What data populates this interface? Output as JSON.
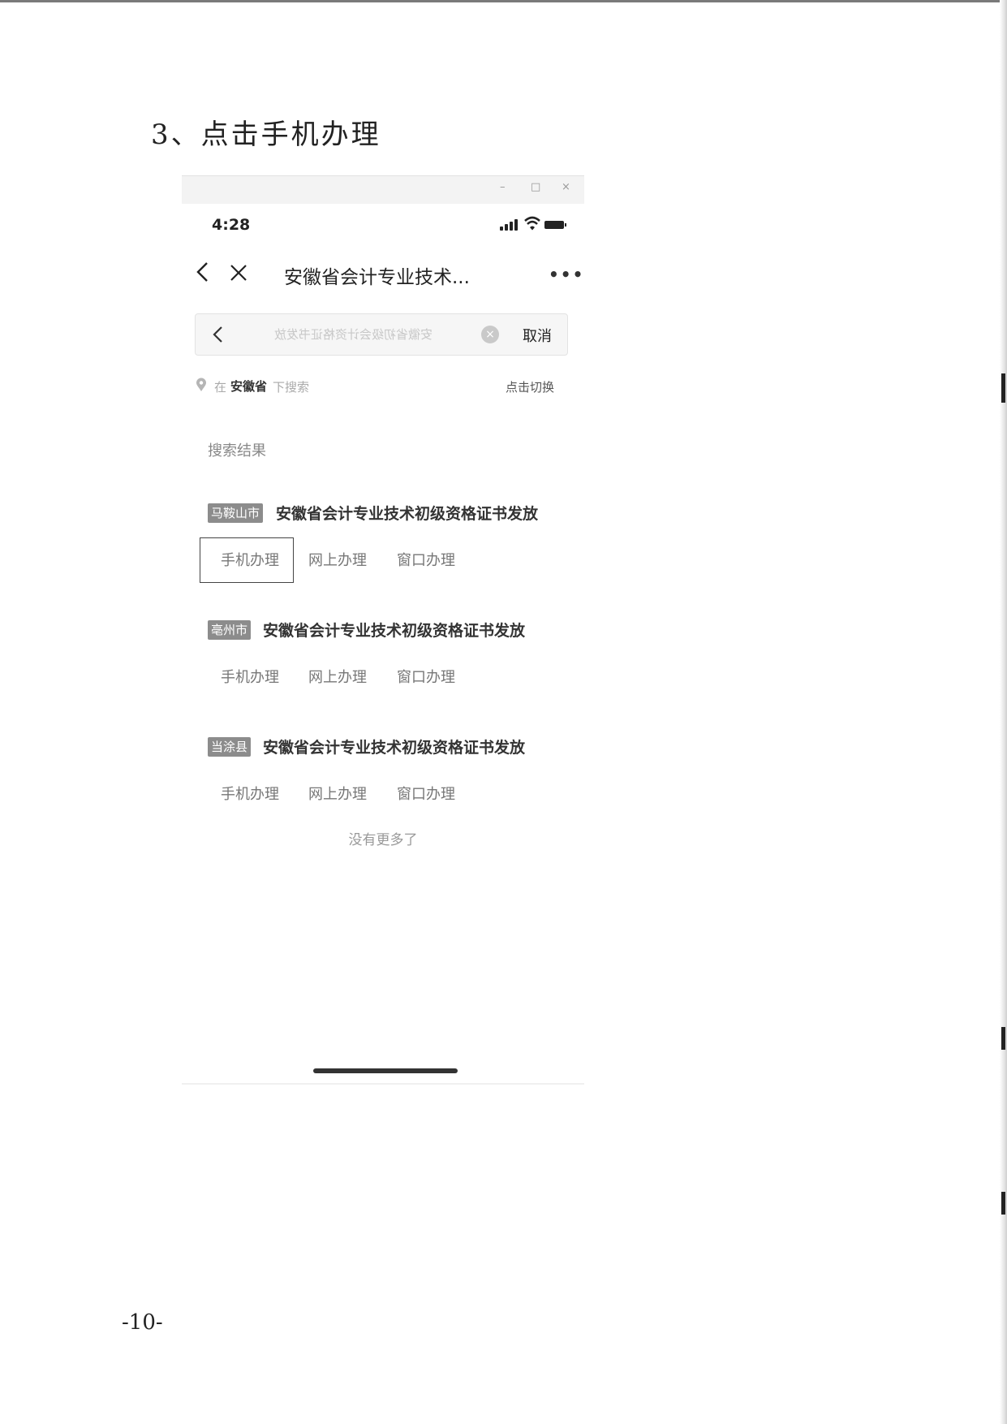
{
  "document": {
    "step_title": "3、点击手机办理",
    "page_number": "-10-"
  },
  "window": {
    "controls": {
      "minimize": "–",
      "maximize": "□",
      "close": "×"
    }
  },
  "status_bar": {
    "time": "4:28",
    "icons": [
      "signal-icon",
      "wifi-icon",
      "battery-icon"
    ]
  },
  "nav": {
    "title": "安徽省会计专业技术...",
    "more": "•••"
  },
  "search": {
    "query": "安徽省初级会计资格证书发放",
    "cancel_label": "取消",
    "clear_icon": "×"
  },
  "location": {
    "prefix": "在",
    "province": "安徽省",
    "suffix": "下搜索",
    "switch_label": "点击切换"
  },
  "results": {
    "heading": "搜索结果",
    "items": [
      {
        "region": "马鞍山市",
        "title": "安徽省会计专业技术初级资格证书发放",
        "actions": [
          "手机办理",
          "网上办理",
          "窗口办理"
        ]
      },
      {
        "region": "亳州市",
        "title": "安徽省会计专业技术初级资格证书发放",
        "actions": [
          "手机办理",
          "网上办理",
          "窗口办理"
        ]
      },
      {
        "region": "当涂县",
        "title": "安徽省会计专业技术初级资格证书发放",
        "actions": [
          "手机办理",
          "网上办理",
          "窗口办理"
        ]
      }
    ],
    "end_text": "没有更多了"
  },
  "colors": {
    "badge": "#8c8c8c",
    "text": "#333333",
    "muted": "#999999"
  }
}
